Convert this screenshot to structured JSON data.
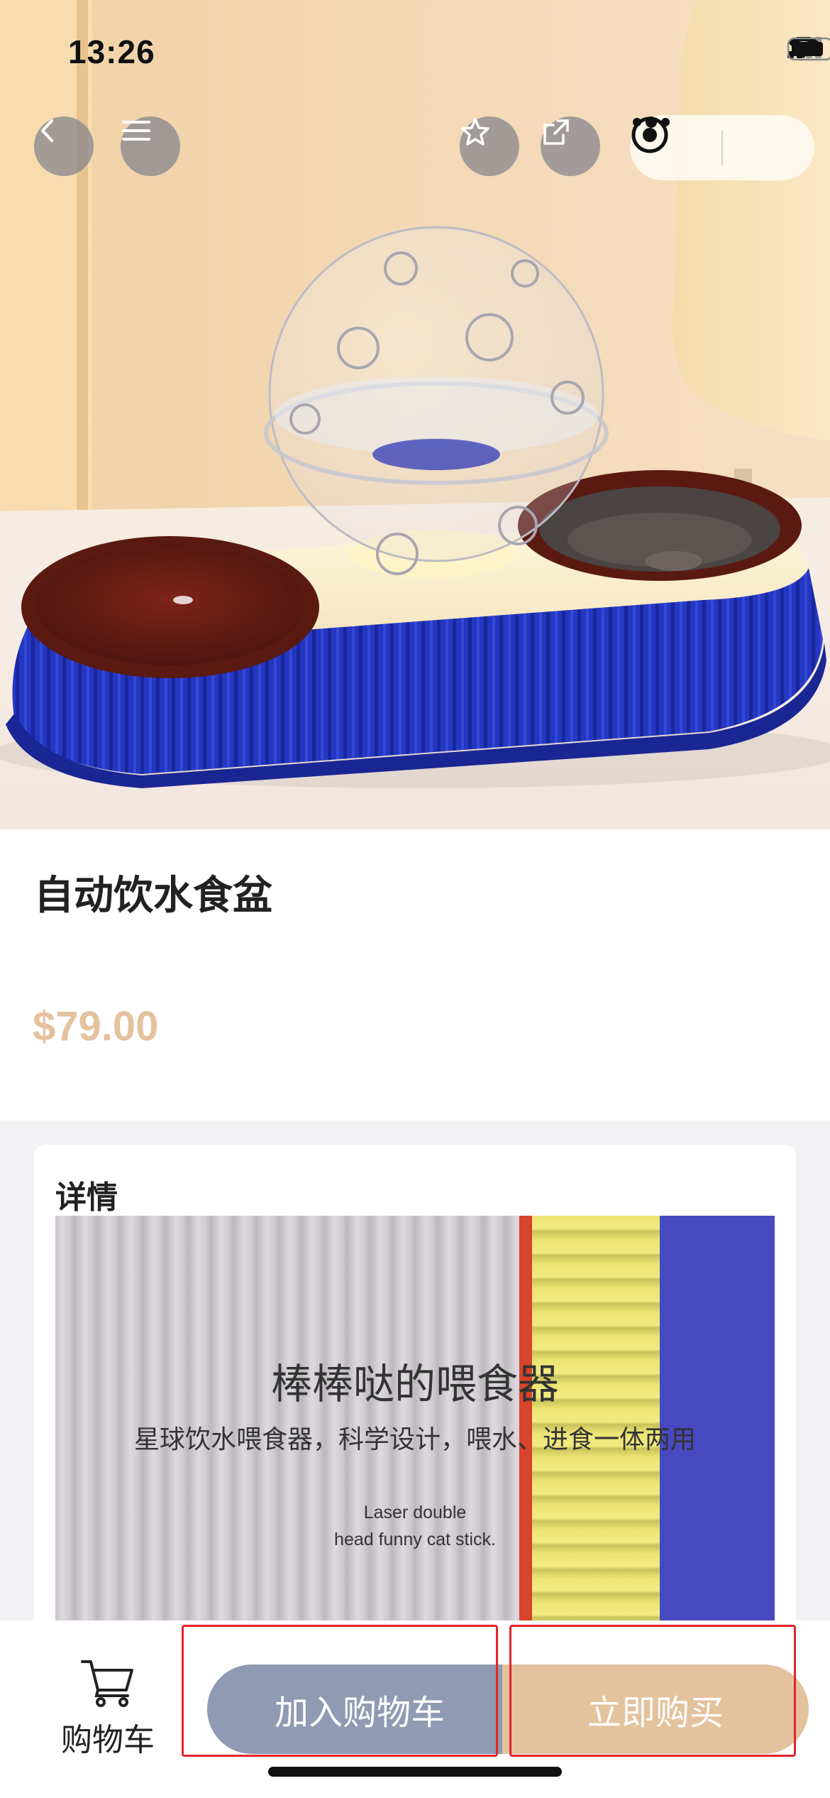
{
  "status_bar": {
    "time": "13:26"
  },
  "nav": {
    "back_icon": "chevron-left-icon",
    "menu_icon": "hamburger-icon",
    "favorite_icon": "star-icon",
    "share_icon": "share-icon",
    "more_icon": "more-dots-icon",
    "close_icon": "target-circle-icon"
  },
  "product": {
    "title": "自动饮水食盆",
    "price": "$79.00"
  },
  "details": {
    "heading": "详情",
    "image_text": {
      "headline": "棒棒哒的喂食器",
      "subline": "星球饮水喂食器，科学设计，喂水、进食一体两用",
      "english_line_1": "Laser double",
      "english_line_2": "head funny cat stick."
    }
  },
  "bottom_bar": {
    "cart_label": "购物车",
    "add_to_cart_label": "加入购物车",
    "buy_now_label": "立即购买"
  },
  "colors": {
    "price": "#e3c29d",
    "add_to_cart_bg": "#8f9bb2",
    "buy_now_bg": "#e3c29d",
    "highlight_box": "#e4252b"
  }
}
